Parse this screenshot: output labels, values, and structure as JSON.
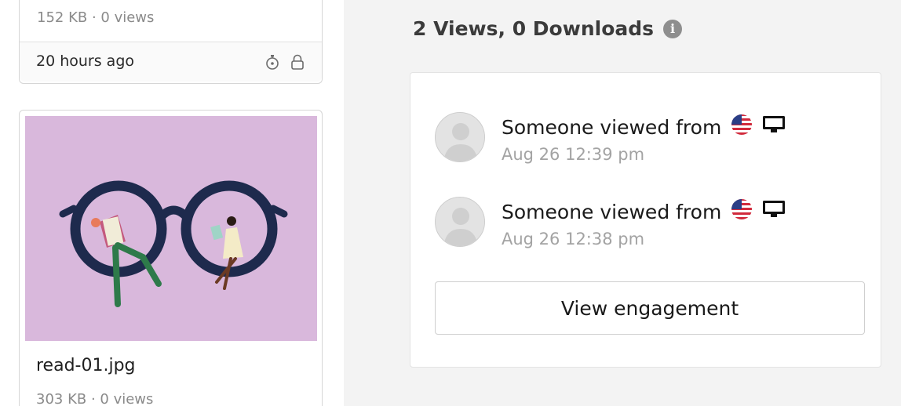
{
  "files": [
    {
      "meta": "152 KB · 0 views",
      "time": "20 hours ago"
    },
    {
      "name": "read-01.jpg",
      "meta": "303 KB · 0 views"
    }
  ],
  "engagement": {
    "stats_title": "2 Views, 0 Downloads",
    "info_icon": "i",
    "views": [
      {
        "text": "Someone viewed from",
        "time": "Aug 26 12:39 pm",
        "country": "US",
        "device": "desktop"
      },
      {
        "text": "Someone viewed from",
        "time": "Aug 26 12:38 pm",
        "country": "US",
        "device": "desktop"
      }
    ],
    "button_label": "View engagement"
  },
  "colors": {
    "right_bg": "#f3f3f3",
    "thumb_bg": "#d9b8dc",
    "muted_text": "#8a8a8a",
    "timestamp_text": "#a3a3a3"
  }
}
